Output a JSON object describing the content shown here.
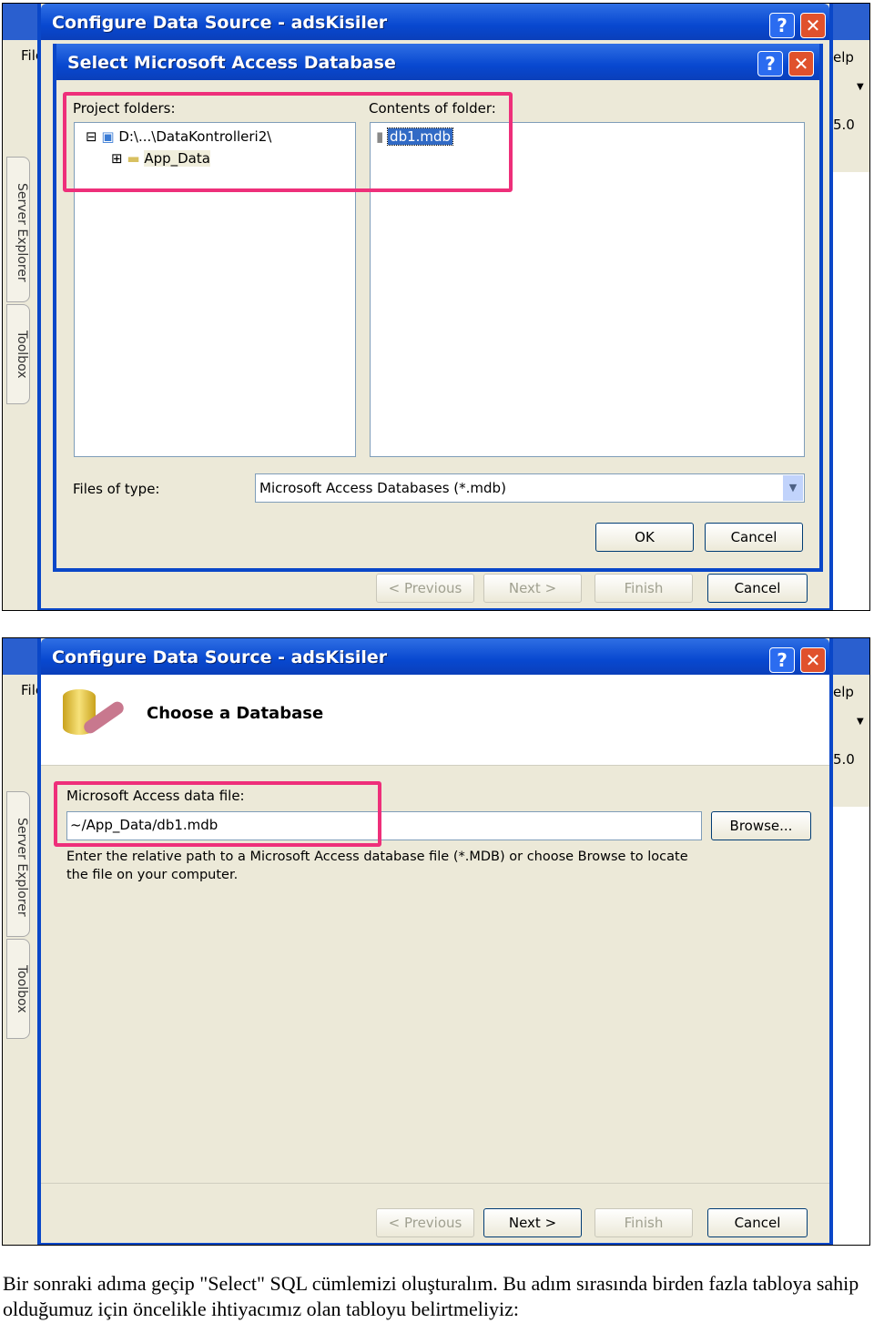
{
  "ide": {
    "menu_file": "File",
    "menu_help": "elp",
    "version_text": "5.0",
    "side_tabs": [
      "Server Explorer",
      "Toolbox"
    ]
  },
  "screen1": {
    "outer_title": "Configure Data Source - adsKisiler",
    "inner_title": "Select Microsoft Access Database",
    "project_folders_label": "Project folders:",
    "contents_label": "Contents of folder:",
    "tree": [
      {
        "label": "D:\\...\\DataKontrolleri2\\",
        "expander": "⊟"
      },
      {
        "label": "App_Data",
        "expander": "⊞"
      }
    ],
    "files": [
      "db1.mdb"
    ],
    "files_of_type_label": "Files of type:",
    "files_of_type_value": "Microsoft Access Databases (*.mdb)",
    "ok": "OK",
    "cancel": "Cancel",
    "wizard_buttons": {
      "previous": "< Previous",
      "next": "Next >",
      "finish": "Finish",
      "cancel": "Cancel"
    }
  },
  "screen2": {
    "outer_title": "Configure Data Source - adsKisiler",
    "heading": "Choose a Database",
    "file_label": "Microsoft Access data file:",
    "file_value": "~/App_Data/db1.mdb",
    "browse": "Browse...",
    "help_line1": "Enter the relative path to a Microsoft Access database file (*.MDB) or choose Browse to locate",
    "help_line2": "the file on your computer.",
    "wizard_buttons": {
      "previous": "< Previous",
      "next": "Next >",
      "finish": "Finish",
      "cancel": "Cancel"
    }
  },
  "caption": "Bir sonraki adıma geçip \"Select\" SQL cümlemizi oluşturalım. Bu adım sırasında birden fazla tabloya sahip olduğumuz için öncelikle ihtiyacımız olan tabloyu belirtmeliyiz:",
  "colors": {
    "title_blue": "#0848d0",
    "highlight": "#ee2f7a",
    "dialog_bg": "#ece9d8"
  }
}
